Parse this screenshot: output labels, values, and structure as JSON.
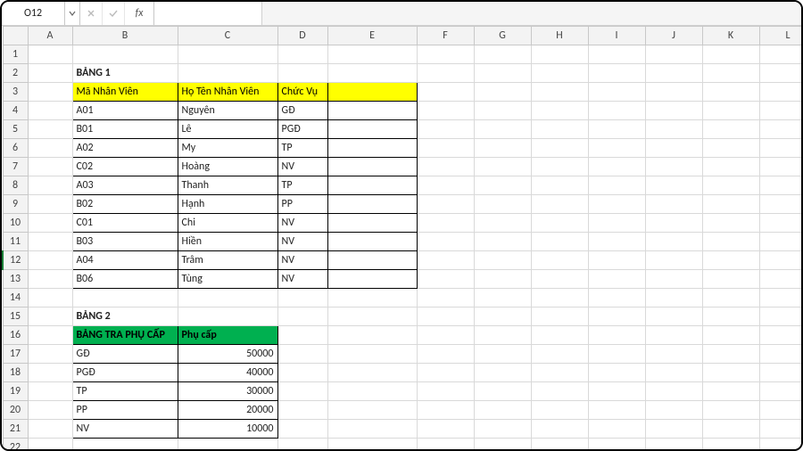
{
  "nameBox": "O12",
  "fxLabel": "fx",
  "formula": "",
  "columns": [
    "A",
    "B",
    "C",
    "D",
    "E",
    "F",
    "G",
    "H",
    "I",
    "J",
    "K",
    "L"
  ],
  "rowCount": 22,
  "activeRow": 12,
  "table1": {
    "title": "BẢNG 1",
    "headers": {
      "b": "Mã Nhân Viên",
      "c": "Họ Tên Nhân Viên",
      "d": "Chức Vụ",
      "e": ""
    },
    "rows": [
      {
        "b": "A01",
        "c": "Nguyên",
        "d": "GĐ",
        "e": ""
      },
      {
        "b": "B01",
        "c": "Lê",
        "d": "PGĐ",
        "e": ""
      },
      {
        "b": "A02",
        "c": "My",
        "d": "TP",
        "e": ""
      },
      {
        "b": "C02",
        "c": "Hoàng",
        "d": "NV",
        "e": ""
      },
      {
        "b": "A03",
        "c": "Thanh",
        "d": "TP",
        "e": ""
      },
      {
        "b": "B02",
        "c": "Hạnh",
        "d": "PP",
        "e": ""
      },
      {
        "b": "C01",
        "c": "Chi",
        "d": "NV",
        "e": ""
      },
      {
        "b": "B03",
        "c": "Hiền",
        "d": "NV",
        "e": ""
      },
      {
        "b": "A04",
        "c": "Trâm",
        "d": "NV",
        "e": ""
      },
      {
        "b": "B06",
        "c": "Tùng",
        "d": "NV",
        "e": ""
      }
    ]
  },
  "table2": {
    "title": "BẢNG 2",
    "headers": {
      "b": "BẢNG TRA PHỤ CẤP",
      "c": "Phụ cấp"
    },
    "rows": [
      {
        "b": "GĐ",
        "c": "50000"
      },
      {
        "b": "PGĐ",
        "c": "40000"
      },
      {
        "b": "TP",
        "c": "30000"
      },
      {
        "b": "PP",
        "c": "20000"
      },
      {
        "b": "NV",
        "c": "10000"
      }
    ]
  }
}
